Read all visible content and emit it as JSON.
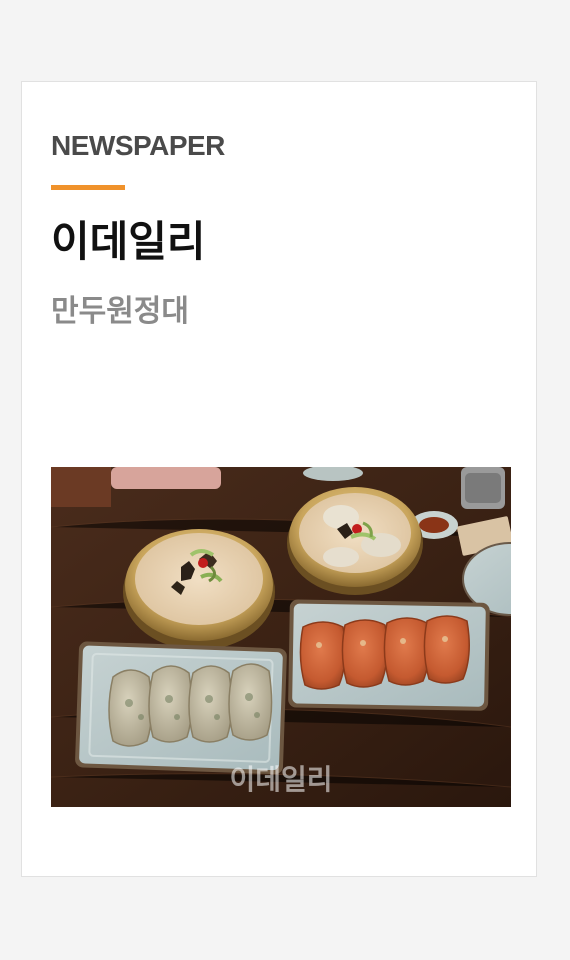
{
  "card": {
    "category": "NEWSPAPER",
    "publisher": "이데일리",
    "subtitle": "만두원정대",
    "accent_color": "#f0922b"
  },
  "photo": {
    "watermark": "이데일리",
    "icon": "food-photo"
  }
}
